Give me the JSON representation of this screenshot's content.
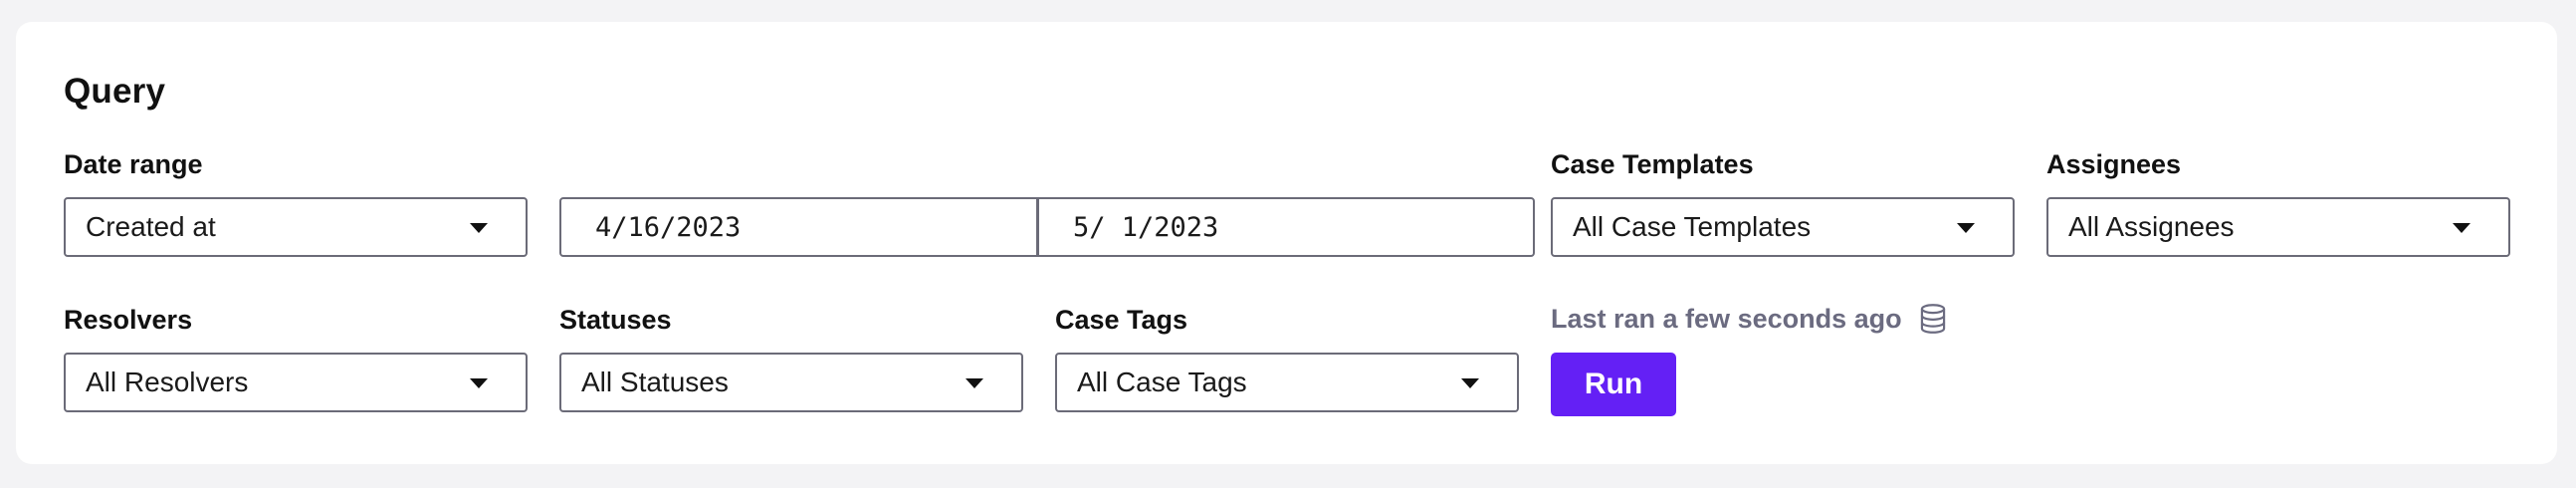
{
  "query": {
    "title": "Query",
    "date_range": {
      "label": "Date range",
      "field_value": "Created at",
      "start_date": "4/16/2023",
      "end_date": "5/ 1/2023"
    },
    "case_templates": {
      "label": "Case Templates",
      "value": "All Case Templates"
    },
    "assignees": {
      "label": "Assignees",
      "value": "All Assignees"
    },
    "resolvers": {
      "label": "Resolvers",
      "value": "All Resolvers"
    },
    "statuses": {
      "label": "Statuses",
      "value": "All Statuses"
    },
    "case_tags": {
      "label": "Case Tags",
      "value": "All Case Tags"
    },
    "last_ran": "Last ran a few seconds ago",
    "run_label": "Run"
  },
  "icons": {
    "dropdown": "caret-down-icon",
    "last_ran": "database-icon"
  },
  "colors": {
    "accent": "#6420f5",
    "background": "#f3f3f5",
    "card": "#ffffff",
    "muted_text": "#6b6b80",
    "input_border": "#6b6b78"
  }
}
